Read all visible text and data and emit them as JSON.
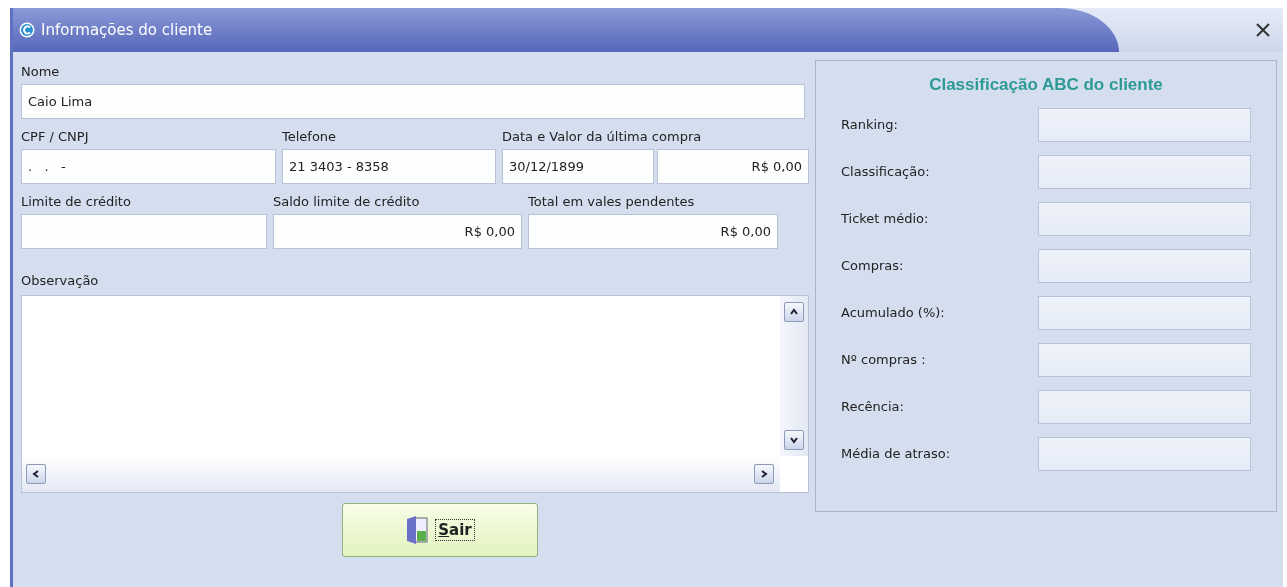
{
  "window": {
    "title": "Informações do cliente"
  },
  "customer": {
    "name": {
      "label": "Nome",
      "value": "Caio Lima"
    },
    "row_1": [
      {
        "label": "CPF / CNPJ",
        "values": [
          {
            "value": ".   .   -"
          }
        ]
      },
      {
        "label": "Telefone",
        "values": [
          {
            "value": "21 3403 - 8358"
          }
        ]
      },
      {
        "label": "Data e Valor da última compra",
        "values": [
          {
            "value": "30/12/1899"
          },
          {
            "value": "R$ 0,00"
          }
        ]
      }
    ],
    "row_2": [
      {
        "label": "Limite de crédito"
      },
      {
        "label": "Saldo limite de crédito",
        "values": [
          {
            "value": "R$ 0,00"
          }
        ]
      },
      {
        "label": "Total em vales pendentes",
        "values": [
          {
            "value": "R$ 0,00"
          }
        ]
      }
    ],
    "notes": {
      "label": "Observação"
    }
  },
  "abc": {
    "title": "Classificação ABC do cliente",
    "rows": [
      {
        "label": "Ranking:"
      },
      {
        "label": "Classificação:"
      },
      {
        "label": "Ticket médio:"
      },
      {
        "label": "Compras:"
      },
      {
        "label": "Acumulado (%):"
      },
      {
        "label": "Nº compras :"
      },
      {
        "label": "Recência:"
      },
      {
        "label": "Média de atraso:"
      }
    ]
  },
  "button": {
    "label": "Sair"
  }
}
